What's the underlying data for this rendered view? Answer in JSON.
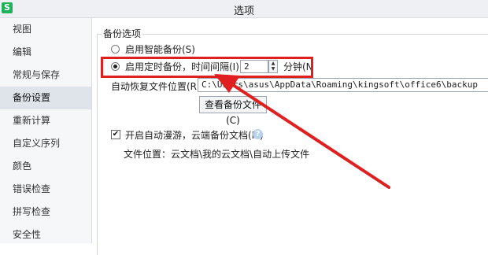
{
  "window": {
    "title": "选项",
    "logo_glyph": "S"
  },
  "sidebar": {
    "items": [
      {
        "label": "视图"
      },
      {
        "label": "编辑"
      },
      {
        "label": "常规与保存"
      },
      {
        "label": "备份设置",
        "active": true
      },
      {
        "label": "重新计算"
      },
      {
        "label": "自定义序列"
      },
      {
        "label": "颜色"
      },
      {
        "label": "错误检查"
      },
      {
        "label": "拼写检查"
      },
      {
        "label": "安全性"
      }
    ]
  },
  "backup": {
    "group_title": "备份选项",
    "smart_backup_label": "启用智能备份(S)",
    "smart_backup_selected": false,
    "timed_backup_label": "启用定时备份，时间间隔(I):",
    "timed_backup_selected": true,
    "interval_value": "2",
    "interval_unit_label": "分钟(N",
    "recovery_path_label": "自动恢复文件位置(R):",
    "recovery_path_value": "C:\\Users\\asus\\AppData\\Roaming\\kingsoft\\office6\\backup",
    "view_backup_button": "查看备份文件(C)",
    "roaming_label": "开启自动漫游，云端备份文档(M)",
    "roaming_checked": true,
    "file_location_label": "文件位置：云文档\\我的云文档\\自动上传文件"
  },
  "icons": {
    "help": "help-icon",
    "spin_up": "chevron-up-icon",
    "spin_down": "chevron-down-icon",
    "checkmark": "checkmark-icon"
  },
  "colors": {
    "annotation": "#e02020",
    "sidebar_active": "#dfe3ea",
    "logo": "#1eb25b"
  }
}
